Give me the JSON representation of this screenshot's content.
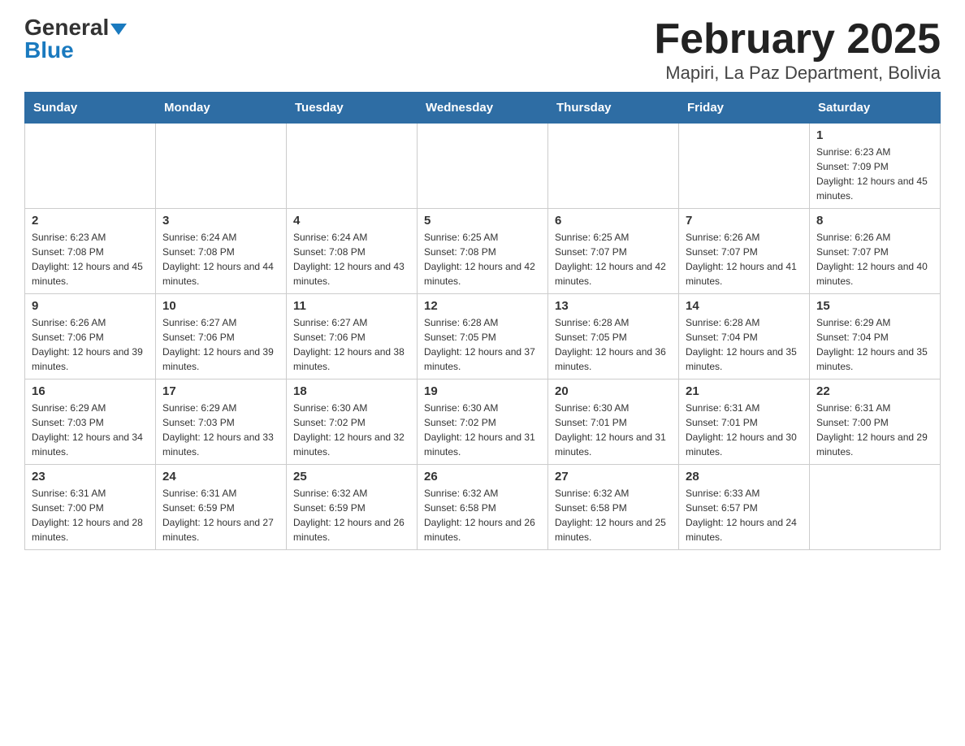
{
  "logo": {
    "general": "General",
    "blue": "Blue"
  },
  "title": "February 2025",
  "subtitle": "Mapiri, La Paz Department, Bolivia",
  "weekdays": [
    "Sunday",
    "Monday",
    "Tuesday",
    "Wednesday",
    "Thursday",
    "Friday",
    "Saturday"
  ],
  "weeks": [
    [
      {
        "day": "",
        "info": ""
      },
      {
        "day": "",
        "info": ""
      },
      {
        "day": "",
        "info": ""
      },
      {
        "day": "",
        "info": ""
      },
      {
        "day": "",
        "info": ""
      },
      {
        "day": "",
        "info": ""
      },
      {
        "day": "1",
        "info": "Sunrise: 6:23 AM\nSunset: 7:09 PM\nDaylight: 12 hours and 45 minutes."
      }
    ],
    [
      {
        "day": "2",
        "info": "Sunrise: 6:23 AM\nSunset: 7:08 PM\nDaylight: 12 hours and 45 minutes."
      },
      {
        "day": "3",
        "info": "Sunrise: 6:24 AM\nSunset: 7:08 PM\nDaylight: 12 hours and 44 minutes."
      },
      {
        "day": "4",
        "info": "Sunrise: 6:24 AM\nSunset: 7:08 PM\nDaylight: 12 hours and 43 minutes."
      },
      {
        "day": "5",
        "info": "Sunrise: 6:25 AM\nSunset: 7:08 PM\nDaylight: 12 hours and 42 minutes."
      },
      {
        "day": "6",
        "info": "Sunrise: 6:25 AM\nSunset: 7:07 PM\nDaylight: 12 hours and 42 minutes."
      },
      {
        "day": "7",
        "info": "Sunrise: 6:26 AM\nSunset: 7:07 PM\nDaylight: 12 hours and 41 minutes."
      },
      {
        "day": "8",
        "info": "Sunrise: 6:26 AM\nSunset: 7:07 PM\nDaylight: 12 hours and 40 minutes."
      }
    ],
    [
      {
        "day": "9",
        "info": "Sunrise: 6:26 AM\nSunset: 7:06 PM\nDaylight: 12 hours and 39 minutes."
      },
      {
        "day": "10",
        "info": "Sunrise: 6:27 AM\nSunset: 7:06 PM\nDaylight: 12 hours and 39 minutes."
      },
      {
        "day": "11",
        "info": "Sunrise: 6:27 AM\nSunset: 7:06 PM\nDaylight: 12 hours and 38 minutes."
      },
      {
        "day": "12",
        "info": "Sunrise: 6:28 AM\nSunset: 7:05 PM\nDaylight: 12 hours and 37 minutes."
      },
      {
        "day": "13",
        "info": "Sunrise: 6:28 AM\nSunset: 7:05 PM\nDaylight: 12 hours and 36 minutes."
      },
      {
        "day": "14",
        "info": "Sunrise: 6:28 AM\nSunset: 7:04 PM\nDaylight: 12 hours and 35 minutes."
      },
      {
        "day": "15",
        "info": "Sunrise: 6:29 AM\nSunset: 7:04 PM\nDaylight: 12 hours and 35 minutes."
      }
    ],
    [
      {
        "day": "16",
        "info": "Sunrise: 6:29 AM\nSunset: 7:03 PM\nDaylight: 12 hours and 34 minutes."
      },
      {
        "day": "17",
        "info": "Sunrise: 6:29 AM\nSunset: 7:03 PM\nDaylight: 12 hours and 33 minutes."
      },
      {
        "day": "18",
        "info": "Sunrise: 6:30 AM\nSunset: 7:02 PM\nDaylight: 12 hours and 32 minutes."
      },
      {
        "day": "19",
        "info": "Sunrise: 6:30 AM\nSunset: 7:02 PM\nDaylight: 12 hours and 31 minutes."
      },
      {
        "day": "20",
        "info": "Sunrise: 6:30 AM\nSunset: 7:01 PM\nDaylight: 12 hours and 31 minutes."
      },
      {
        "day": "21",
        "info": "Sunrise: 6:31 AM\nSunset: 7:01 PM\nDaylight: 12 hours and 30 minutes."
      },
      {
        "day": "22",
        "info": "Sunrise: 6:31 AM\nSunset: 7:00 PM\nDaylight: 12 hours and 29 minutes."
      }
    ],
    [
      {
        "day": "23",
        "info": "Sunrise: 6:31 AM\nSunset: 7:00 PM\nDaylight: 12 hours and 28 minutes."
      },
      {
        "day": "24",
        "info": "Sunrise: 6:31 AM\nSunset: 6:59 PM\nDaylight: 12 hours and 27 minutes."
      },
      {
        "day": "25",
        "info": "Sunrise: 6:32 AM\nSunset: 6:59 PM\nDaylight: 12 hours and 26 minutes."
      },
      {
        "day": "26",
        "info": "Sunrise: 6:32 AM\nSunset: 6:58 PM\nDaylight: 12 hours and 26 minutes."
      },
      {
        "day": "27",
        "info": "Sunrise: 6:32 AM\nSunset: 6:58 PM\nDaylight: 12 hours and 25 minutes."
      },
      {
        "day": "28",
        "info": "Sunrise: 6:33 AM\nSunset: 6:57 PM\nDaylight: 12 hours and 24 minutes."
      },
      {
        "day": "",
        "info": ""
      }
    ]
  ]
}
